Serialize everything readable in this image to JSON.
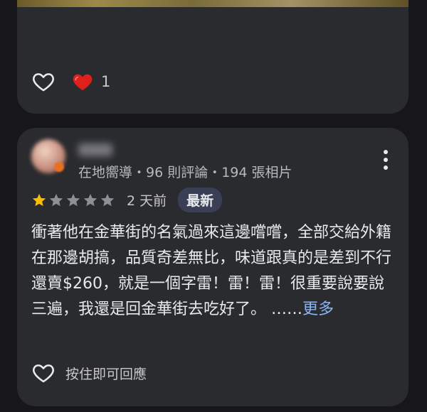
{
  "previous_review": {
    "like_count": "1"
  },
  "review": {
    "meta": "在地嚮導・96 則評論・194 張相片",
    "rating": 1,
    "rating_max": 5,
    "date": "2 天前",
    "badge": "最新",
    "text": "衝著他在金華街的名氣過來這邊嚐嚐，全部交給外籍在那邊胡搞，品質奇差無比，味道跟真的是差到不行還賣$260，就是一個字雷！雷！雷！很重要說要說三遍，我還是回金華街去吃好了。 ……",
    "more_label": "更多",
    "reply_label": "按住即可回應"
  },
  "colors": {
    "star_filled": "#fbbc04",
    "star_empty": "#8e9095",
    "heart_red": "#e0201b",
    "link": "#8ab4f8",
    "badge_bg": "#3a3f55"
  },
  "icons": {
    "like": "heart-outline-icon",
    "reaction": "heart-filled-icon",
    "more": "more-vert-icon",
    "star": "star-icon"
  }
}
